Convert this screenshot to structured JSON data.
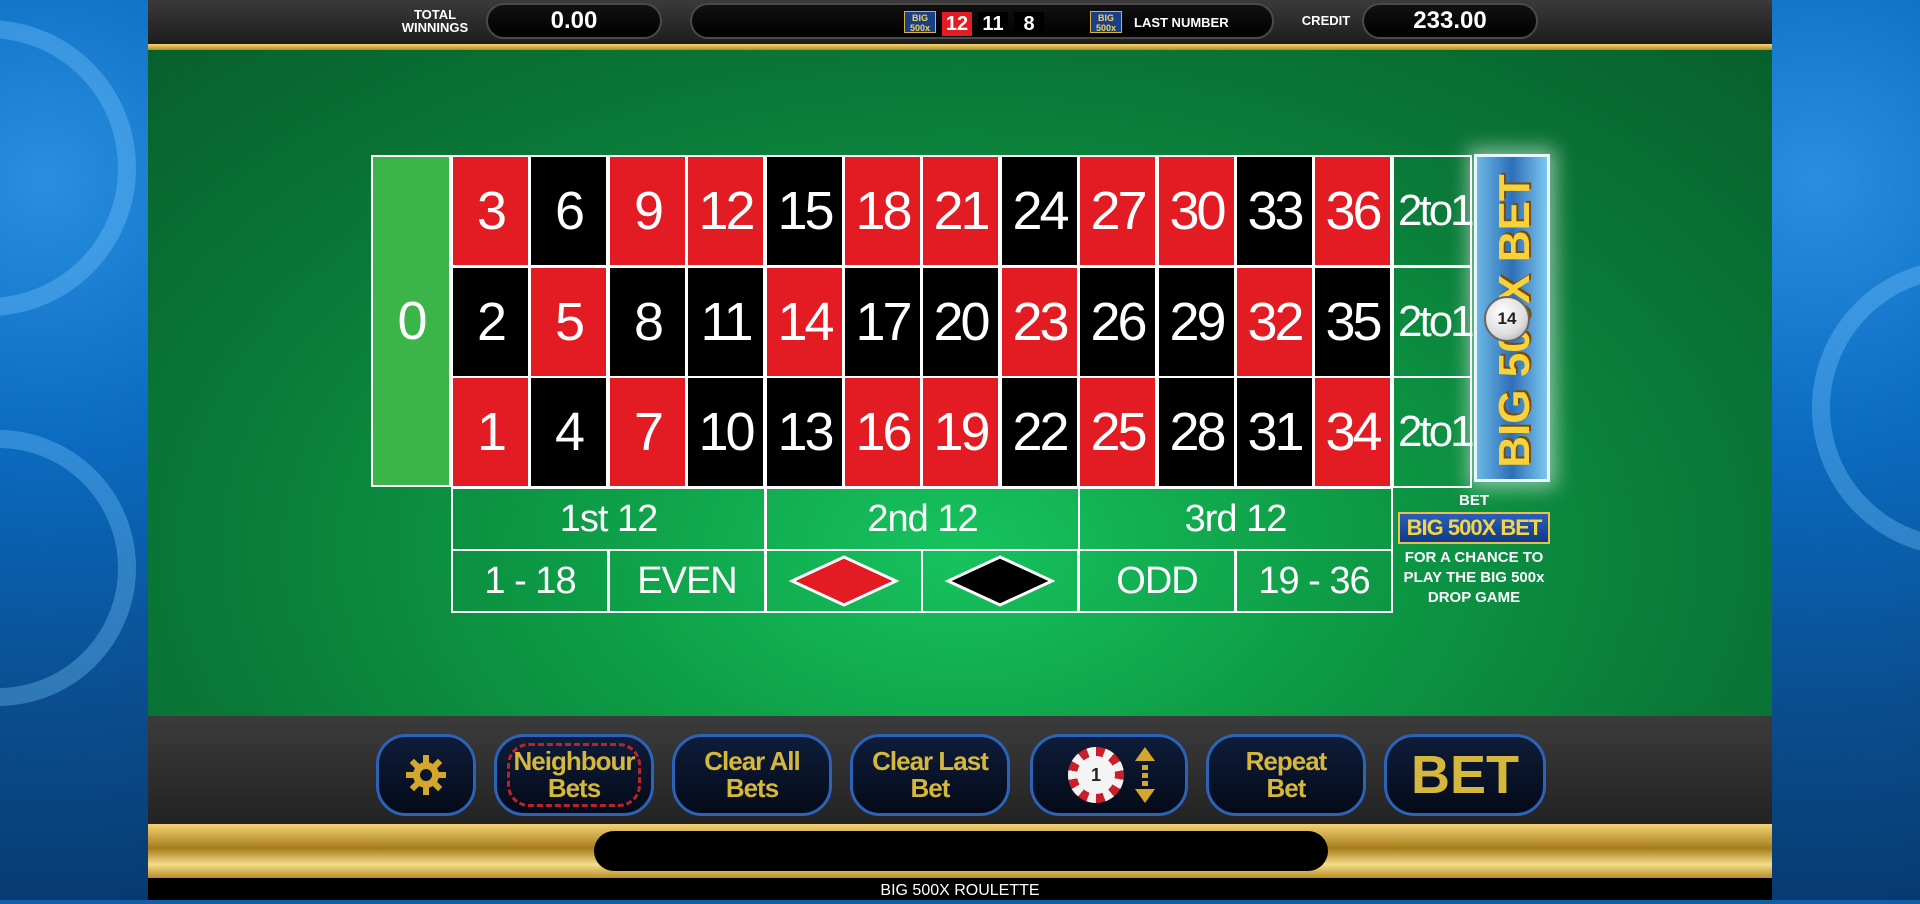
{
  "header": {
    "total_winnings_label_1": "TOTAL",
    "total_winnings_label_2": "WINNINGS",
    "total_winnings_value": "0.00",
    "last_number_label": "LAST NUMBER",
    "credit_label": "CREDIT",
    "credit_value": "233.00",
    "history": [
      {
        "value": "12",
        "color": "red"
      },
      {
        "value": "11",
        "color": "black"
      },
      {
        "value": "8",
        "color": "black"
      }
    ],
    "big_badge_line1": "BIG",
    "big_badge_line2": "500x"
  },
  "board": {
    "zero": "0",
    "rows": [
      [
        {
          "n": "3",
          "c": "red"
        },
        {
          "n": "6",
          "c": "black"
        },
        {
          "n": "9",
          "c": "red"
        },
        {
          "n": "12",
          "c": "red"
        },
        {
          "n": "15",
          "c": "black"
        },
        {
          "n": "18",
          "c": "red"
        },
        {
          "n": "21",
          "c": "red"
        },
        {
          "n": "24",
          "c": "black"
        },
        {
          "n": "27",
          "c": "red"
        },
        {
          "n": "30",
          "c": "red"
        },
        {
          "n": "33",
          "c": "black"
        },
        {
          "n": "36",
          "c": "red"
        }
      ],
      [
        {
          "n": "2",
          "c": "black"
        },
        {
          "n": "5",
          "c": "red"
        },
        {
          "n": "8",
          "c": "black"
        },
        {
          "n": "11",
          "c": "black"
        },
        {
          "n": "14",
          "c": "red"
        },
        {
          "n": "17",
          "c": "black"
        },
        {
          "n": "20",
          "c": "black"
        },
        {
          "n": "23",
          "c": "red"
        },
        {
          "n": "26",
          "c": "black"
        },
        {
          "n": "29",
          "c": "black"
        },
        {
          "n": "32",
          "c": "red"
        },
        {
          "n": "35",
          "c": "black"
        }
      ],
      [
        {
          "n": "1",
          "c": "red"
        },
        {
          "n": "4",
          "c": "black"
        },
        {
          "n": "7",
          "c": "red"
        },
        {
          "n": "10",
          "c": "black"
        },
        {
          "n": "13",
          "c": "black"
        },
        {
          "n": "16",
          "c": "red"
        },
        {
          "n": "19",
          "c": "red"
        },
        {
          "n": "22",
          "c": "black"
        },
        {
          "n": "25",
          "c": "red"
        },
        {
          "n": "28",
          "c": "black"
        },
        {
          "n": "31",
          "c": "black"
        },
        {
          "n": "34",
          "c": "red"
        }
      ]
    ],
    "columns": [
      "2to1",
      "2to1",
      "2to1"
    ],
    "dozens": [
      "1st 12",
      "2nd 12",
      "3rd 12"
    ],
    "outside": {
      "low": "1 - 18",
      "even": "EVEN",
      "odd": "ODD",
      "high": "19 - 36"
    },
    "colors": {
      "red": "#e31b23",
      "black": "#000000",
      "green": "#3bb54a"
    }
  },
  "big500": {
    "side_text": "BIG 500X BET",
    "ball_number": "14",
    "promo_bet": "BET",
    "promo_badge": "BIG 500X BET",
    "promo_line1": "FOR A CHANCE TO",
    "promo_line2": "PLAY THE BIG 500x",
    "promo_line3": "DROP GAME"
  },
  "controls": {
    "neighbour_1": "Neighbour",
    "neighbour_2": "Bets",
    "clear_all_1": "Clear All",
    "clear_all_2": "Bets",
    "clear_last_1": "Clear Last",
    "clear_last_2": "Bet",
    "chip_value": "1",
    "repeat_1": "Repeat",
    "repeat_2": "Bet",
    "bet": "BET"
  },
  "footer": {
    "title": "BIG 500X ROULETTE"
  }
}
